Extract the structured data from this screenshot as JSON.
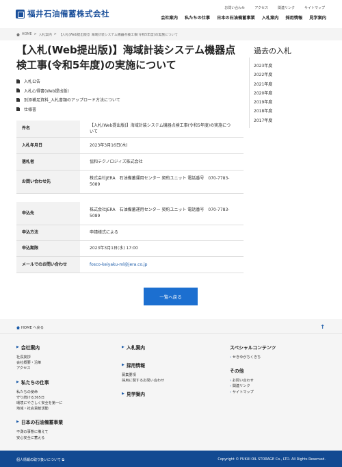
{
  "header": {
    "logo": "福井石油備蓄株式会社",
    "util": [
      "お問い合わせ",
      "アクセス",
      "関連リンク",
      "サイトマップ"
    ],
    "nav": [
      "会社案内",
      "私たちの仕事",
      "日本の石油備蓄事業",
      "入札案内",
      "採用情報",
      "見学案内"
    ]
  },
  "breadcrumb": [
    "HOME",
    "入札案内",
    "【入札(Web提出版)】海域計装システム機器点検工事(令和5年度)の実施について"
  ],
  "page": {
    "title": "【入札(Web提出版)】海域計装システム機器点検工事(令和5年度)の実施について",
    "docs": [
      "入札公告",
      "入札心得書(Web提出版)",
      "別添補足資料_入札書類のアップロード方法について",
      "仕様書"
    ]
  },
  "table1": [
    {
      "k": "件名",
      "v": "【入札(Web提出版)】海域計装システム機器点検工事(令和5年度)の実施について"
    },
    {
      "k": "入札年月日",
      "v": "2023年3月16日(木)"
    },
    {
      "k": "落札者",
      "v": "協和テクノロジィズ株式会社"
    },
    {
      "k": "お問い合わせ先",
      "v": "株式会社JERA　石油備蓄運用センター 契約ユニット 電話番号　070-7783-5089"
    }
  ],
  "table2": [
    {
      "k": "申込先",
      "v": "株式会社JERA　石油備蓄運用センター 契約ユニット 電話番号　070-7783-5089"
    },
    {
      "k": "申込方法",
      "v": "申請様式による"
    },
    {
      "k": "申込期限",
      "v": "2023年3月1日(水) 17:00"
    },
    {
      "k": "メールでのお問い合わせ",
      "v": "fosco-keiyaku-ml@jera.co.jp"
    }
  ],
  "button": "一覧へ戻る",
  "sidebar": {
    "title": "過去の入札",
    "years": [
      "2023年度",
      "2022年度",
      "2021年度",
      "2020年度",
      "2019年度",
      "2018年度",
      "2017年度"
    ]
  },
  "footer": {
    "home": "HOME へ戻る",
    "col1": [
      {
        "h": "会社案内",
        "items": [
          "社長挨拶",
          "会社概要・沿革",
          "アクセス"
        ]
      },
      {
        "h": "私たちの仕事",
        "items": [
          "私たちの使命",
          "守り続ける365日",
          "環境にやさしく安全を第一に",
          "地域・社会貢献活動"
        ]
      },
      {
        "h": "日本の石油備蓄事業",
        "items": [
          "不測の事態に備えて",
          "安心安全に蓄える"
        ]
      }
    ],
    "col2": [
      {
        "h": "入札案内",
        "items": []
      },
      {
        "h": "採用情報",
        "items": [
          "募集要項",
          "採用に関するお問い合わせ"
        ]
      },
      {
        "h": "見学案内",
        "items": []
      }
    ],
    "col3": [
      {
        "h": "スペシャルコンテンツ",
        "items": [
          "せきゆがちくきち"
        ]
      },
      {
        "h": "その他",
        "items": [
          "お問い合わせ",
          "関連リンク",
          "サイトマップ"
        ]
      }
    ],
    "privacy": "個人情報の取り扱いについて",
    "copyright": "Copyright © FUKUI OIL STORAGE Co., LTD. All Rights Reserved."
  }
}
